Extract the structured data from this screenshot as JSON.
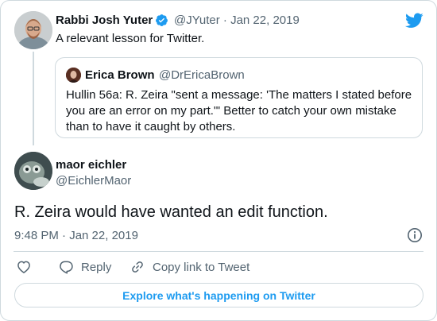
{
  "parent_tweet": {
    "author_name": "Rabbi Josh Yuter",
    "handle_date": "@JYuter · Jan 22, 2019",
    "text": "A relevant lesson for Twitter.",
    "verified_icon": "verified-badge-icon"
  },
  "quoted_tweet": {
    "author_name": "Erica Brown",
    "handle": "@DrEricaBrown",
    "text": "Hullin 56a: R. Zeira \"sent a message: 'The matters I stated before you are an error on my part.'\" Better to catch your own mistake than to have it caught by others."
  },
  "main_tweet": {
    "author_name": "maor eichler",
    "handle": "@EichlerMaor",
    "text": "R. Zeira would have wanted an edit function.",
    "timestamp": "9:48 PM · Jan 22, 2019"
  },
  "actions": {
    "reply_label": "Reply",
    "copy_link_label": "Copy link to Tweet"
  },
  "footer": {
    "explore_label": "Explore what's happening on Twitter"
  },
  "colors": {
    "accent": "#1d9bf0",
    "secondary_text": "#536471",
    "border": "#cfd9de"
  }
}
